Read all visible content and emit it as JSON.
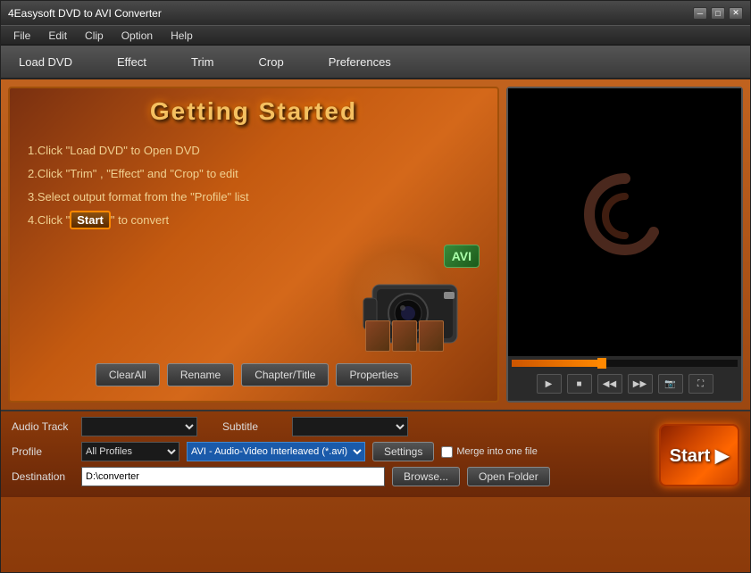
{
  "titlebar": {
    "title": "4Easysoft DVD to AVI Converter",
    "minimize": "─",
    "maximize": "□",
    "close": "✕"
  },
  "menubar": {
    "items": [
      "File",
      "Edit",
      "Clip",
      "Option",
      "Help"
    ]
  },
  "toolbar": {
    "items": [
      "Load DVD",
      "Effect",
      "Trim",
      "Crop",
      "Preferences"
    ]
  },
  "getting_started": {
    "title": "Getting  Started",
    "steps": [
      "1.Click \"Load DVD\" to Open DVD",
      "2.Click \"Trim\" , \"Effect\" and \"Crop\" to edit",
      "3.Select output format from the \"Profile\" list",
      "4.Click \""
    ],
    "step4_start": "Start",
    "step4_end": "\" to convert"
  },
  "buttons": {
    "clear_all": "ClearAll",
    "rename": "Rename",
    "chapter_title": "Chapter/Title",
    "properties": "Properties"
  },
  "avi_badge": "AVI",
  "video_controls": {
    "play": "▶",
    "stop": "■",
    "rewind": "◀◀",
    "forward": "▶▶",
    "snapshot": "📷",
    "fullscreen": "⛶"
  },
  "form": {
    "audio_track_label": "Audio Track",
    "subtitle_label": "Subtitle",
    "profile_label": "Profile",
    "destination_label": "Destination",
    "audio_track_placeholder": "",
    "subtitle_placeholder": "",
    "profile_category": "All Profiles",
    "profile_format": "AVI - Audio-Video Interleaved (*.avi)",
    "destination_value": "D:\\converter",
    "settings_btn": "Settings",
    "merge_label": "Merge into one file",
    "browse_btn": "Browse...",
    "open_folder_btn": "Open Folder",
    "start_btn": "Start ▶"
  }
}
